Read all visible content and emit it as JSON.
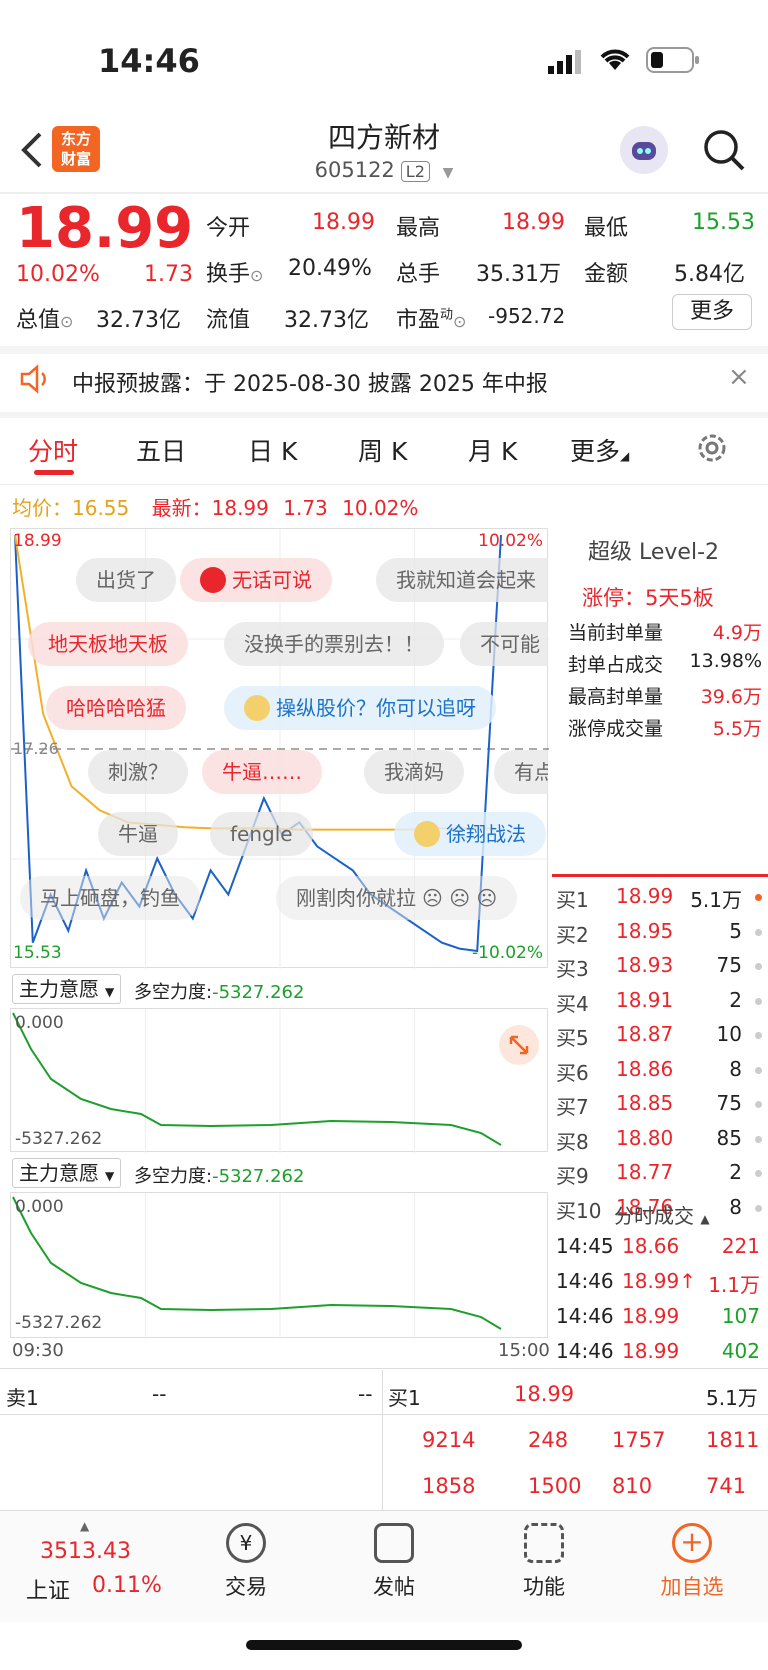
{
  "status": {
    "time": "14:46"
  },
  "header": {
    "logo": "东方\n财富",
    "title": "四方新材",
    "code": "605122",
    "level": "L2"
  },
  "quote": {
    "price": "18.99",
    "pct": "10.02%",
    "change": "1.73",
    "open_label": "今开",
    "open": "18.99",
    "high_label": "最高",
    "high": "18.99",
    "low_label": "最低",
    "low": "15.53",
    "turnover_label": "换手",
    "turnover": "20.49%",
    "vol_label": "总手",
    "vol": "35.31万",
    "amount_label": "金额",
    "amount": "5.84亿",
    "mcap_label": "总值",
    "mcap": "32.73亿",
    "float_label": "流值",
    "float": "32.73亿",
    "pe_label": "市盈",
    "pe_sup": "动",
    "pe": "-952.72",
    "more_button": "更多"
  },
  "notice": {
    "text": "中报预披露：于 2025-08-30 披露 2025 年中报"
  },
  "tabs": [
    "分时",
    "五日",
    "日 K",
    "周 K",
    "月 K",
    "更多"
  ],
  "info_line": {
    "avg_label": "均价：",
    "avg": "16.55",
    "latest_label": "最新：",
    "latest": "18.99",
    "chg": "1.73",
    "pct": "10.02%"
  },
  "chart": {
    "top_left": "18.99",
    "top_right": "10.02%",
    "bottom_left": "15.53",
    "bottom_right": "-10.02%",
    "mid": "17.26",
    "start_time": "09:30",
    "end_time": "15:00",
    "chart_data": {
      "type": "line",
      "series": [
        {
          "values": [
            18.99,
            15.6,
            16.0,
            15.7,
            16.2,
            15.8,
            16.1,
            15.9,
            16.3,
            16.0,
            15.8,
            16.2,
            16.0,
            16.4,
            16.8,
            16.5,
            16.6,
            16.4,
            16.3,
            16.2,
            16.0,
            15.9,
            15.8,
            15.7,
            15.6,
            15.55,
            15.53,
            18.99
          ]
        },
        {
          "values": [
            18.99,
            17.5,
            16.9,
            16.7,
            16.6,
            16.58,
            16.56,
            16.55,
            16.55,
            16.55,
            16.54,
            16.54,
            16.54,
            16.54,
            16.54,
            16.55,
            16.55,
            16.55
          ]
        }
      ],
      "ylim": [
        15.53,
        18.99
      ]
    }
  },
  "danmu": [
    {
      "text": "出货了",
      "style": "gray"
    },
    {
      "text": "无话可说",
      "style": "red"
    },
    {
      "text": "我就知道会起来",
      "style": "gray"
    },
    {
      "text": "地天板地天板",
      "style": "red"
    },
    {
      "text": "没换手的票别去！！",
      "style": "gray"
    },
    {
      "text": "不可能",
      "style": "gray"
    },
    {
      "text": "哈哈哈哈猛",
      "style": "red"
    },
    {
      "text": "操纵股价？你可以追呀",
      "style": "blue"
    },
    {
      "text": "刺激？",
      "style": "gray"
    },
    {
      "text": "牛逼……",
      "style": "red"
    },
    {
      "text": "我滴妈",
      "style": "gray"
    },
    {
      "text": "有点",
      "style": "gray"
    },
    {
      "text": "牛逼",
      "style": "gray"
    },
    {
      "text": "fengle",
      "style": "gray"
    },
    {
      "text": "徐翔战法",
      "style": "blue"
    },
    {
      "text": "马上砸盘，钓鱼",
      "style": "gray"
    },
    {
      "text": "刚割肉你就拉",
      "style": "gray"
    }
  ],
  "indicator1": {
    "label": "主力意愿",
    "force_label": "多空力度:",
    "force": "-5327.262",
    "top": "0.000",
    "bottom": "-5327.262"
  },
  "indicator2": {
    "label": "主力意愿",
    "force_label": "多空力度:",
    "force": "-5327.262",
    "top": "0.000",
    "bottom": "-5327.262"
  },
  "level2": {
    "title": "超级 Level-2",
    "limit": "涨停：5天5板",
    "rows": [
      {
        "k": "当前封单量",
        "v": "4.9万"
      },
      {
        "k": "封单占成交",
        "v": "13.98%"
      },
      {
        "k": "最高封单量",
        "v": "39.6万"
      },
      {
        "k": "涨停成交量",
        "v": "5.5万"
      }
    ]
  },
  "book": [
    {
      "label": "买1",
      "price": "18.99",
      "vol": "5.1万"
    },
    {
      "label": "买2",
      "price": "18.95",
      "vol": "5"
    },
    {
      "label": "买3",
      "price": "18.93",
      "vol": "75"
    },
    {
      "label": "买4",
      "price": "18.91",
      "vol": "2"
    },
    {
      "label": "买5",
      "price": "18.87",
      "vol": "10"
    },
    {
      "label": "买6",
      "price": "18.86",
      "vol": "8"
    },
    {
      "label": "买7",
      "price": "18.85",
      "vol": "75"
    },
    {
      "label": "买8",
      "price": "18.80",
      "vol": "85"
    },
    {
      "label": "买9",
      "price": "18.77",
      "vol": "2"
    },
    {
      "label": "买10",
      "price": "18.76",
      "vol": "8"
    }
  ],
  "ticks": {
    "title": "分时成交",
    "rows": [
      {
        "t": "14:45",
        "p": "18.66",
        "v": "221",
        "c": "red"
      },
      {
        "t": "14:46",
        "p": "18.99↑",
        "v": "1.1万",
        "c": "red"
      },
      {
        "t": "14:46",
        "p": "18.99",
        "v": "107",
        "c": "green"
      },
      {
        "t": "14:46",
        "p": "18.99",
        "v": "402",
        "c": "green"
      }
    ]
  },
  "bottom_book": {
    "sell_label": "卖1",
    "sell_price": "--",
    "sell_vol": "--",
    "buy_label": "买1",
    "buy_price": "18.99",
    "buy_vol": "5.1万",
    "row1": [
      "9214",
      "248",
      "1757",
      "1811"
    ],
    "row2": [
      "1858",
      "1500",
      "810",
      "741"
    ]
  },
  "nav": {
    "index_value": "3513.43",
    "index_name": "上证",
    "index_pct": "0.11%",
    "items": [
      "交易",
      "发帖",
      "功能",
      "加自选"
    ]
  }
}
